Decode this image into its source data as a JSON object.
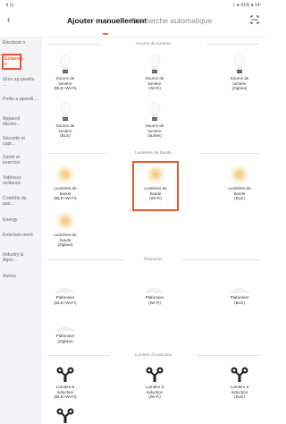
{
  "status_bar": {
    "left": "Ⅱ ⊡",
    "right": "ᛒ ✦ 41% ▮ 14:"
  },
  "header": {
    "back_icon": "chevron-left-icon",
    "tab_manual": "Ajouter manuellement",
    "tab_auto": "Recherche automatique",
    "scan_icon": "scan-icon"
  },
  "sidebar": {
    "items": [
      {
        "label": "Électricie\nn"
      },
      {
        "label": "Éclairag\ne"
      },
      {
        "label": "Gros ap\npareils ..."
      },
      {
        "label": "Petits a\npparell..."
      },
      {
        "label": "Appareil\nélectro..."
      },
      {
        "label": "Sécurité\net capt..."
      },
      {
        "label": "Santé et\nexercice"
      },
      {
        "label": "Vidéosur\nveillance"
      },
      {
        "label": "Contrôle\nde pas..."
      },
      {
        "label": "Energy"
      },
      {
        "label": "Entertain\nment"
      },
      {
        "label": "Industry\n& Agric..."
      },
      {
        "label": "Autres"
      }
    ]
  },
  "sections": [
    {
      "title": "Source de lumière",
      "items": [
        {
          "label": "Source de\nlumière\n(BLE+Wi-Fi)",
          "icon": "bulb-icon"
        },
        {
          "label": "Source de\nlumière\n(Wi-Fi)",
          "icon": "bulb-icon"
        },
        {
          "label": "Source de\nlumière\n(Zigbee)",
          "icon": "bulb-icon"
        },
        {
          "label": "Source de\nlumière\n(BLE)",
          "icon": "bulb-icon"
        },
        {
          "label": "Source de\nlumière\n(autres)",
          "icon": "bulb-icon"
        }
      ]
    },
    {
      "title": "Lumières de bande",
      "items": [
        {
          "label": "Lumières de\nbande\n(BLE+Wi-Fi)",
          "icon": "strip-light-icon"
        },
        {
          "label": "Lumières de\nbande\n(Wi-Fi)",
          "icon": "strip-light-icon"
        },
        {
          "label": "Lumières de\nbande\n(BLE)",
          "icon": "strip-light-icon"
        },
        {
          "label": "Lumières de\nbande\n(Zigbee)",
          "icon": "strip-light-icon"
        }
      ]
    },
    {
      "title": "Plafonnier",
      "items": [
        {
          "label": "Plafonnier\n(BLE+Wi-Fi)",
          "icon": "ceiling-light-icon"
        },
        {
          "label": "Plafonnier\n(Wi-Fi)",
          "icon": "ceiling-light-icon"
        },
        {
          "label": "Plafonnier\n(BLE)",
          "icon": "ceiling-light-icon"
        },
        {
          "label": "Plafonnier\n(Zigbee)",
          "icon": "ceiling-light-icon"
        }
      ]
    },
    {
      "title": "Lumière à induction",
      "items": [
        {
          "label": "Lumière à\ninduction\n(BLE+Wi-Fi)",
          "icon": "induction-light-icon"
        },
        {
          "label": "Lumière à\ninduction\n(Wi-Fi)",
          "icon": "induction-light-icon"
        },
        {
          "label": "Lumière à\ninduction\n(BLE)",
          "icon": "induction-light-icon"
        },
        {
          "label": "",
          "icon": "induction-light-icon"
        }
      ]
    }
  ],
  "colors": {
    "accent": "#ff5a1f",
    "highlight_box": "#e8552e",
    "sidebar_bg": "#f4f4f6"
  }
}
